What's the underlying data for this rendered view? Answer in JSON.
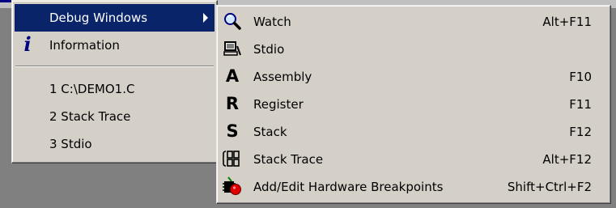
{
  "main_menu": {
    "items": [
      {
        "label": "Debug Windows",
        "selected": true,
        "has_submenu": true,
        "icon": "none"
      },
      {
        "label": "Information",
        "icon": "info-icon"
      }
    ],
    "recent_files": [
      {
        "label": "1 C:\\DEMO1.C"
      },
      {
        "label": "2 Stack Trace"
      },
      {
        "label": "3 Stdio"
      }
    ]
  },
  "submenu": {
    "items": [
      {
        "label": "Watch",
        "shortcut": "Alt+F11",
        "icon": "magnifier-icon"
      },
      {
        "label": "Stdio",
        "shortcut": "",
        "icon": "computer-icon"
      },
      {
        "label": "Assembly",
        "shortcut": "F10",
        "icon": "letter-a-icon",
        "glyph": "A"
      },
      {
        "label": "Register",
        "shortcut": "F11",
        "icon": "letter-r-icon",
        "glyph": "R"
      },
      {
        "label": "Stack",
        "shortcut": "F12",
        "icon": "letter-s-icon",
        "glyph": "S"
      },
      {
        "label": "Stack Trace",
        "shortcut": "Alt+F12",
        "icon": "stack-trace-icon"
      },
      {
        "label": "Add/Edit Hardware Breakpoints",
        "shortcut": "Shift+Ctrl+F2",
        "icon": "hardware-breakpoint-icon"
      }
    ]
  },
  "colors": {
    "menu_bg": "#d4d0c8",
    "highlight": "#0a246a",
    "info_icon": "#000080",
    "breakpoint_red": "#e00000"
  }
}
